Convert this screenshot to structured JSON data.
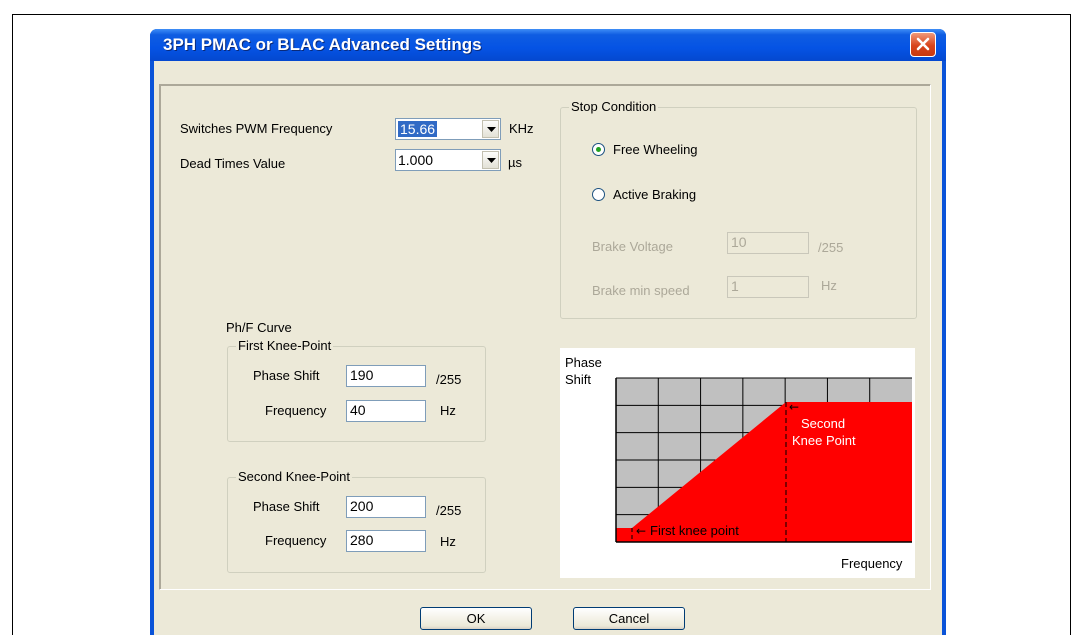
{
  "window": {
    "title": "3PH PMAC or BLAC Advanced Settings"
  },
  "pwm": {
    "label": "Switches PWM Frequency",
    "value": "15.66",
    "unit": "KHz"
  },
  "dead_time": {
    "label": "Dead Times Value",
    "value": "1.000",
    "unit": "µs"
  },
  "stop_condition": {
    "title": "Stop Condition",
    "free_wheeling": "Free Wheeling",
    "active_braking": "Active Braking",
    "selected": "free_wheeling",
    "brake_voltage": {
      "label": "Brake Voltage",
      "value": "10",
      "unit": "/255"
    },
    "brake_min_speed": {
      "label": "Brake min speed",
      "value": "1",
      "unit": "Hz"
    }
  },
  "curve": {
    "title": "Ph/F Curve",
    "first": {
      "title": "First Knee-Point",
      "phase_label": "Phase Shift",
      "phase_value": "190",
      "phase_unit": "/255",
      "freq_label": "Frequency",
      "freq_value": "40",
      "freq_unit": "Hz"
    },
    "second": {
      "title": "Second Knee-Point",
      "phase_label": "Phase Shift",
      "phase_value": "200",
      "phase_unit": "/255",
      "freq_label": "Frequency",
      "freq_value": "280",
      "freq_unit": "Hz"
    }
  },
  "diagram": {
    "y_label_line1": "Phase",
    "y_label_line2": "Shift",
    "x_label": "Frequency",
    "first_knee_label": "First knee point",
    "second_knee_line1": "Second",
    "second_knee_line2": "Knee Point",
    "fill_color": "#ff0000",
    "grid_bg": "#c0c0c0"
  },
  "buttons": {
    "ok": "OK",
    "cancel": "Cancel"
  },
  "icons": {
    "close": "close-icon",
    "dropdown": "chevron-down-icon"
  }
}
